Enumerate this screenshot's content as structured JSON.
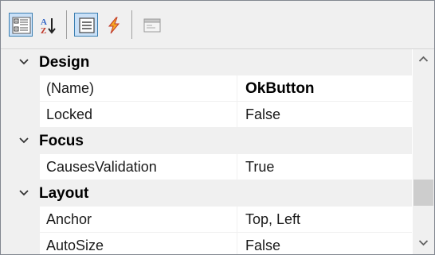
{
  "toolbar": {
    "buttons": [
      {
        "name": "categorized-button",
        "icon": "categorized-icon",
        "checked": true
      },
      {
        "name": "alphabetical-button",
        "icon": "sort-az-icon",
        "checked": false
      },
      {
        "name": "properties-button",
        "icon": "properties-icon",
        "checked": true
      },
      {
        "name": "events-button",
        "icon": "lightning-icon",
        "checked": false
      },
      {
        "name": "property-pages-button",
        "icon": "property-pages-icon",
        "checked": false
      }
    ],
    "sort_letter_top": "A",
    "sort_letter_bottom": "Z"
  },
  "grid": {
    "categories": [
      {
        "label": "Design",
        "expanded": true,
        "properties": [
          {
            "name": "(Name)",
            "value": "OkButton",
            "bold": true
          },
          {
            "name": "Locked",
            "value": "False",
            "bold": false
          }
        ]
      },
      {
        "label": "Focus",
        "expanded": true,
        "properties": [
          {
            "name": "CausesValidation",
            "value": "True",
            "bold": false
          }
        ]
      },
      {
        "label": "Layout",
        "expanded": true,
        "properties": [
          {
            "name": "Anchor",
            "value": "Top, Left",
            "bold": false
          },
          {
            "name": "AutoSize",
            "value": "False",
            "bold": false
          }
        ]
      }
    ]
  },
  "scrollbar": {
    "up_icon": "chevron-up-icon",
    "down_icon": "chevron-down-icon"
  },
  "colors": {
    "chrome": "#f0f0f0",
    "selected_button": "#c9e0f7",
    "selected_border": "#3c7fb1",
    "lightning": "#f5a623",
    "scroll_thumb": "#cdcdcd"
  }
}
